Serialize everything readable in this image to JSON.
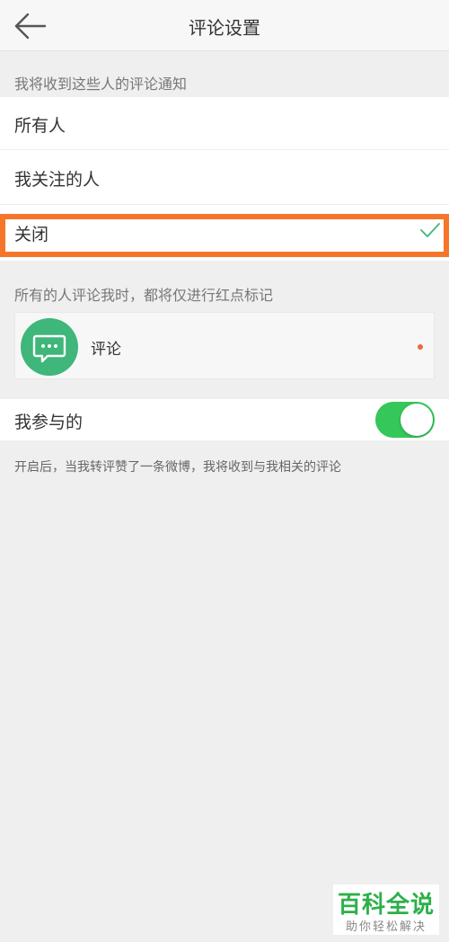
{
  "header": {
    "title": "评论设置",
    "back_icon": "arrow-left-icon"
  },
  "notify_section": {
    "label": "我将收到这些人的评论通知",
    "options": [
      {
        "label": "所有人",
        "selected": false
      },
      {
        "label": "我关注的人",
        "selected": false
      },
      {
        "label": "关闭",
        "selected": true
      }
    ],
    "check_icon": "checkmark-icon",
    "check_color": "#3fb67a",
    "highlight_color": "#f5762a"
  },
  "redpoint_section": {
    "label": "所有的人评论我时，都将仅进行红点标记",
    "card": {
      "icon": "comment-bubble-icon",
      "label": "评论",
      "dot_color": "#f0653a"
    }
  },
  "participate": {
    "label": "我参与的",
    "toggle_on": true,
    "toggle_color": "#35c75a",
    "footnote": "开启后，当我转评赞了一条微博，我将收到与我相关的评论"
  },
  "watermark": {
    "title": "百科全说",
    "subtitle": "助你轻松解决"
  }
}
